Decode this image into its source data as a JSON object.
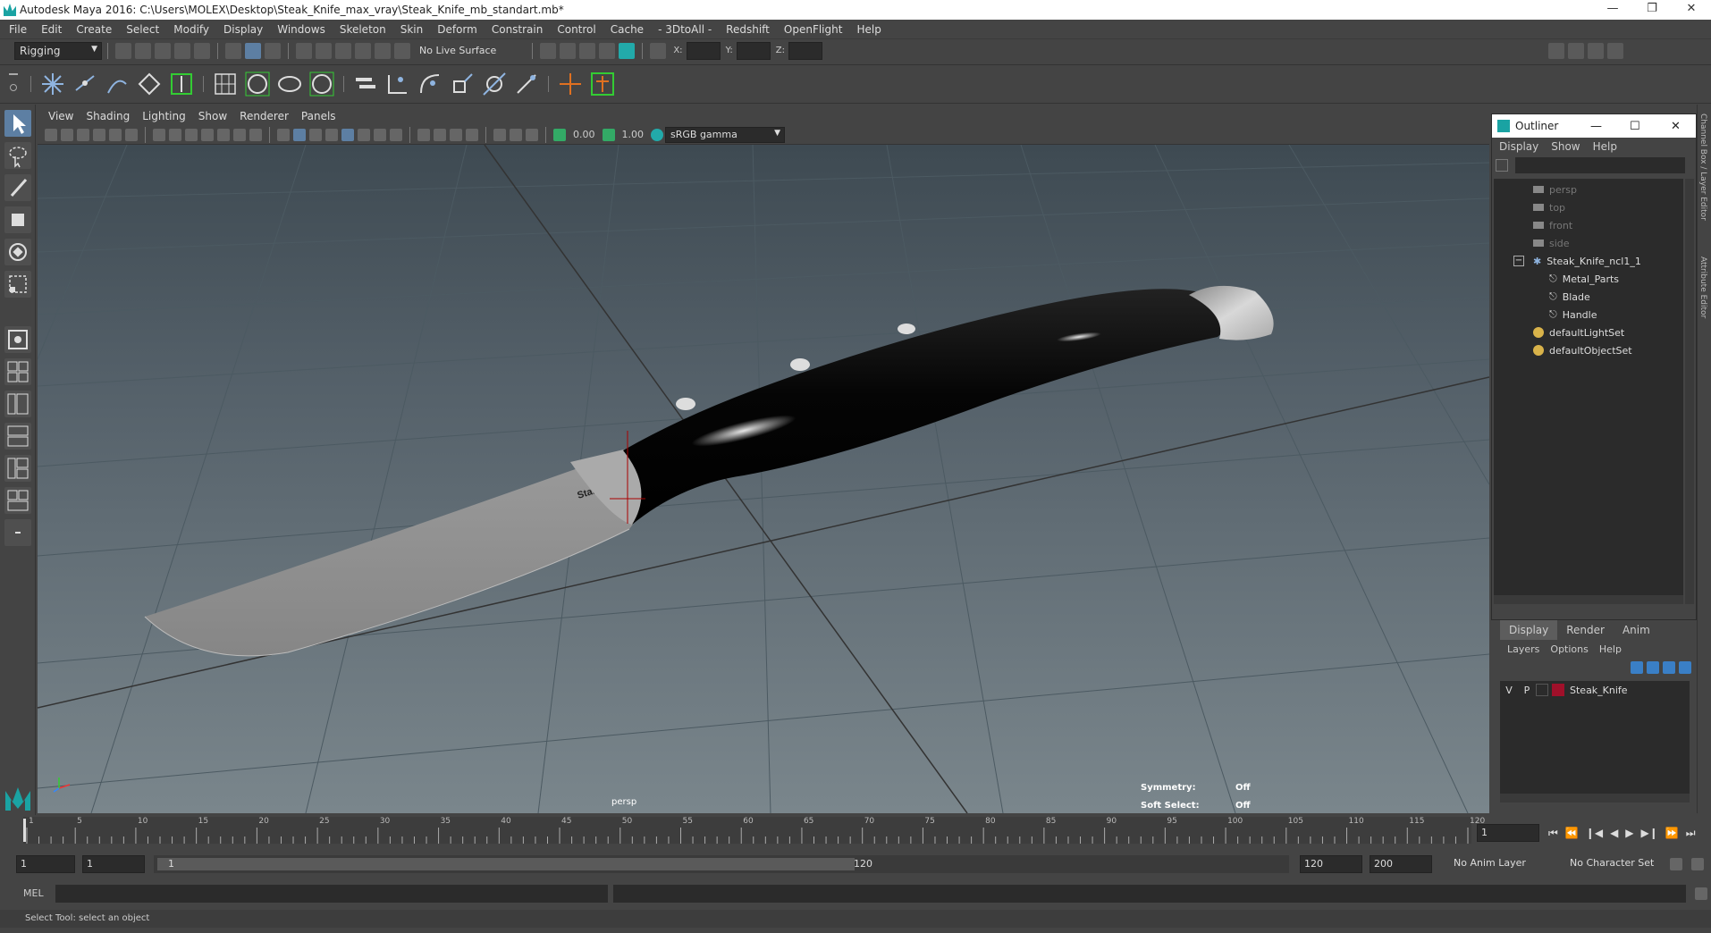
{
  "window": {
    "title": "Autodesk Maya 2016: C:\\Users\\MOLEX\\Desktop\\Steak_Knife_max_vray\\Steak_Knife_mb_standart.mb*",
    "controls": [
      "minimize",
      "restore",
      "close"
    ]
  },
  "menubar": {
    "items": [
      "File",
      "Edit",
      "Create",
      "Select",
      "Modify",
      "Display",
      "Windows",
      "Skeleton",
      "Skin",
      "Deform",
      "Constrain",
      "Control",
      "Cache",
      "- 3DtoAll -",
      "Redshift",
      "OpenFlight",
      "Help"
    ]
  },
  "statusline": {
    "mode": "Rigging",
    "live_surface": "No Live Surface",
    "x_label": "X:",
    "y_label": "Y:",
    "z_label": "Z:"
  },
  "viewport": {
    "menus": [
      "View",
      "Shading",
      "Lighting",
      "Show",
      "Renderer",
      "Panels"
    ],
    "exposure": "0.00",
    "gamma": "1.00",
    "colorspace": "sRGB gamma",
    "camera_label": "persp",
    "symmetry_label": "Symmetry:",
    "symmetry_value": "Off",
    "soft_select_label": "Soft Select:",
    "soft_select_value": "Off",
    "blade_text": "Stainless Steel"
  },
  "outliner": {
    "title": "Outliner",
    "menus": [
      "Display",
      "Show",
      "Help"
    ],
    "items": [
      {
        "label": "persp",
        "type": "camera",
        "dim": true
      },
      {
        "label": "top",
        "type": "camera",
        "dim": true
      },
      {
        "label": "front",
        "type": "camera",
        "dim": true
      },
      {
        "label": "side",
        "type": "camera",
        "dim": true
      },
      {
        "label": "Steak_Knife_ncl1_1",
        "type": "group",
        "dim": false
      },
      {
        "label": "Metal_Parts",
        "type": "mesh",
        "dim": false
      },
      {
        "label": "Blade",
        "type": "mesh",
        "dim": false
      },
      {
        "label": "Handle",
        "type": "mesh",
        "dim": false
      },
      {
        "label": "defaultLightSet",
        "type": "set",
        "dim": false
      },
      {
        "label": "defaultObjectSet",
        "type": "set",
        "dim": false
      }
    ]
  },
  "layers": {
    "tabs": [
      "Display",
      "Render",
      "Anim"
    ],
    "menus": [
      "Layers",
      "Options",
      "Help"
    ],
    "rows": [
      {
        "v": "V",
        "p": "P",
        "name": "Steak_Knife",
        "color": "#a0102a"
      }
    ]
  },
  "timeline": {
    "ticks": [
      "1",
      "5",
      "10",
      "15",
      "20",
      "25",
      "30",
      "35",
      "40",
      "45",
      "50",
      "55",
      "60",
      "65",
      "70",
      "75",
      "80",
      "85",
      "90",
      "95",
      "100",
      "105",
      "110",
      "115",
      "120"
    ],
    "current_frame": "1",
    "range_start": "1",
    "range_inner_start": "1",
    "slider_start": "1",
    "slider_end": "120",
    "range_inner_end": "120",
    "range_end": "200",
    "anim_layer": "No Anim Layer",
    "char_set": "No Character Set"
  },
  "commandline": {
    "lang": "MEL",
    "help": "Select Tool: select an object"
  },
  "side_tabs": [
    "Channel Box / Layer Editor",
    "Attribute Editor"
  ]
}
